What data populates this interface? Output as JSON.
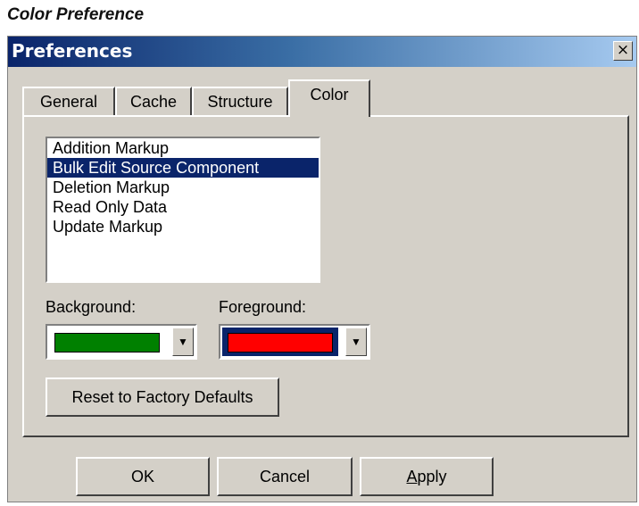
{
  "caption": "Color Preference",
  "window": {
    "title": "Preferences",
    "close_glyph": "×"
  },
  "tabs": [
    {
      "label": "General",
      "active": false
    },
    {
      "label": "Cache",
      "active": false
    },
    {
      "label": "Structure",
      "active": false
    },
    {
      "label": "Color",
      "active": true
    }
  ],
  "color_tab": {
    "items": [
      {
        "label": "Addition Markup",
        "selected": false
      },
      {
        "label": "Bulk Edit Source Component",
        "selected": true
      },
      {
        "label": "Deletion Markup",
        "selected": false
      },
      {
        "label": "Read Only Data",
        "selected": false
      },
      {
        "label": "Update Markup",
        "selected": false
      }
    ],
    "background_label": "Background:",
    "background_color": "#008000",
    "foreground_label": "Foreground:",
    "foreground_color": "#ff0000",
    "reset_label": "Reset to Factory Defaults"
  },
  "buttons": {
    "ok": "OK",
    "cancel": "Cancel",
    "apply_prefix": "A",
    "apply_rest": "pply"
  },
  "colors": {
    "selection": "#0a246a",
    "face": "#d4d0c8"
  }
}
